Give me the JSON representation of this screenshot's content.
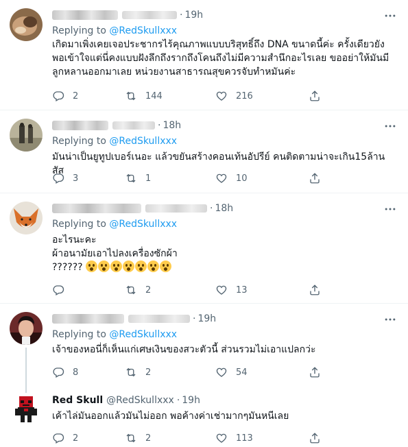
{
  "tweets": [
    {
      "time": "19h",
      "replying_prefix": "Replying to ",
      "mention": "@RedSkullxxx",
      "text": "เกิดมาเพิ่งเคยเจอประชากรไร้คุณภาพแบบบริสุทธิ์ถึง DNA  ขนาดนี้ค่ะ ครั้งเดียวยัง\nพอเข้าใจแต่นี่คงแบบฝังลึกถึงรากถึงโคนถึงไม่มีความสำนึกอะไรเลย ขออย่าให้มันมี\nลูกหลานออกมาเลย หน่วยงานสาธารณสุขควรจับทำหมันค่ะ",
      "replies": "2",
      "retweets": "144",
      "likes": "216"
    },
    {
      "time": "18h",
      "replying_prefix": "Replying to ",
      "mention": "@RedSkullxxx",
      "text": "มันน่าเป็นยูทูปเบอร์เนอะ แล้วขยันสร้างคอนเท้นอัปรีย์ คนติดตามน่าจะเกิน15ล้าน สัส",
      "replies": "3",
      "retweets": "1",
      "likes": "10"
    },
    {
      "time": "18h",
      "replying_prefix": "Replying to ",
      "mention": "@RedSkullxxx",
      "text_line1": "อะไรนะคะ",
      "text_line2": "ผ้าอนามัยเอาไปลงเครื่องซักผ้า",
      "text_line3": "??????",
      "replies": "",
      "retweets": "2",
      "likes": "13"
    },
    {
      "time": "19h",
      "replying_prefix": "Replying to ",
      "mention": "@RedSkullxxx",
      "text": "เจ้าของหอนี่ก็เห็นแก่เศษเงินของสวะตัวนี้ ส่วนรวมไม่เอาแปลกว่ะ",
      "replies": "8",
      "retweets": "2",
      "likes": "54"
    },
    {
      "name": "Red Skull",
      "handle": "@RedSkullxxx",
      "time": "19h",
      "text": "เค้าไล่มันออกแล้วมันไม่ออก พอค้างค่าเช่ามากๆมันหนีเลย",
      "replies": "2",
      "retweets": "2",
      "likes": "113"
    }
  ],
  "icons": {
    "reply": "reply-icon",
    "retweet": "retweet-icon",
    "like": "heart-icon",
    "share": "share-icon",
    "more": "more-icon"
  },
  "colors": {
    "link": "#1d9bf0",
    "muted": "#536471",
    "text": "#0f1419",
    "divider": "#eff3f4"
  }
}
